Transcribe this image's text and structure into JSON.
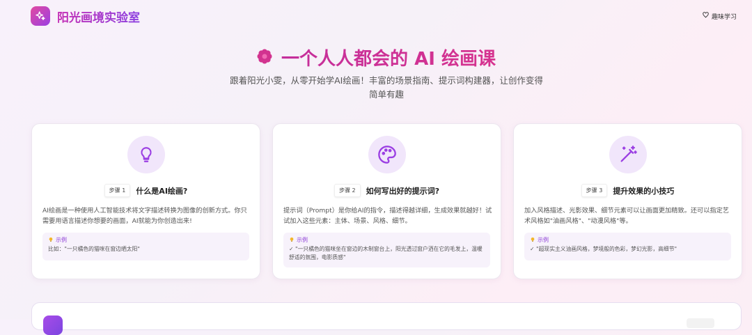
{
  "header": {
    "brand": "阳光画境实验室",
    "fav_label": "趣味学习",
    "logo_icon": "sparkle-icon",
    "fav_icon": "heart-icon"
  },
  "hero": {
    "title": "一个人人都会的 AI 绘画课",
    "subtitle": "跟着阳光小雯，从零开始学AI绘画！丰富的场景指南、提示词构建器，让创作变得简单有趣",
    "icon": "flower-icon"
  },
  "cards": [
    {
      "icon": "lightbulb-icon",
      "step": "步骤 1",
      "title": "什么是AI绘画?",
      "desc": "AI绘画是一种使用人工智能技术将文字描述转换为图像的创新方式。你只需要用语言描述你想要的画面，AI就能为你创造出来!",
      "example_label": "示例",
      "example_text": "比如：\"一只橘色的猫咪在窗边晒太阳\""
    },
    {
      "icon": "palette-icon",
      "step": "步骤 2",
      "title": "如何写出好的提示词?",
      "desc": "提示词（Prompt）是你给AI的指令，描述得越详细，生成效果就越好！试试加入这些元素：主体、场景、风格、细节。",
      "example_label": "示例",
      "example_text": "✓ \"一只橘色的猫咪坐在窗边的木制窗台上，阳光透过窗户洒在它的毛发上，温暖舒适的氛围，电影质感\""
    },
    {
      "icon": "magic-wand-icon",
      "step": "步骤 3",
      "title": "提升效果的小技巧",
      "desc": "加入风格描述、光影效果、细节元素可以让画面更加精致。还可以指定艺术风格如\"油画风格\"、\"动漫风格\"等。",
      "example_label": "示例",
      "example_text": "✓ \"超现实主义油画风格，梦境般的色彩，梦幻光影，高细节\""
    }
  ],
  "colors": {
    "accent": "#c42e9b",
    "purple": "#8e3fd6"
  }
}
